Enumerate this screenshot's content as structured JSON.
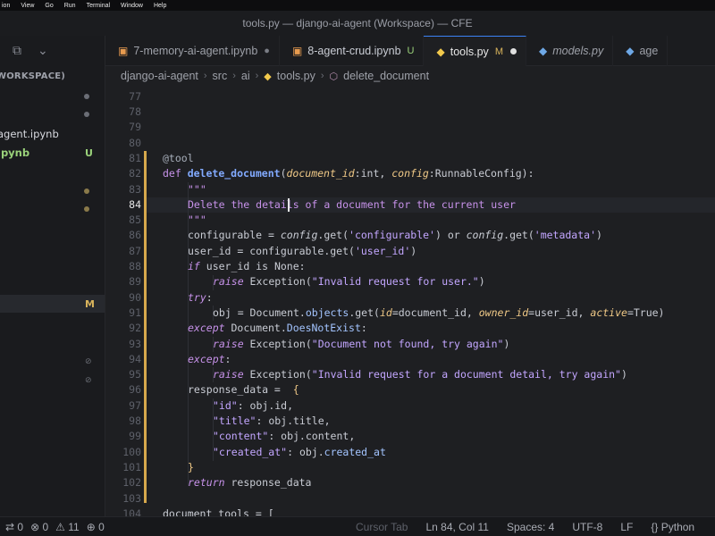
{
  "menubar": [
    "ion",
    "View",
    "Go",
    "Run",
    "Terminal",
    "Window",
    "Help"
  ],
  "window_title": "tools.py — django-ai-agent (Workspace) — CFE",
  "sidebar": {
    "header": "WORKSPACE)",
    "items": [
      {
        "label": "",
        "mark": "dot"
      },
      {
        "label": "",
        "mark": "dot"
      },
      {
        "label": "agent.ipynb",
        "mark": ""
      },
      {
        "label": "ipynb",
        "mark": "U"
      },
      {
        "label": "",
        "mark": "dot"
      },
      {
        "label": "",
        "mark": "dot"
      },
      {
        "label": "",
        "mark": "M"
      },
      {
        "label": "",
        "mark": "⊘"
      },
      {
        "label": "",
        "mark": "⊘"
      }
    ]
  },
  "tabs": [
    {
      "label": "7-memory-ai-agent.ipynb",
      "mark": "●",
      "active": false
    },
    {
      "label": "8-agent-crud.ipynb",
      "mark": "U",
      "active": false
    },
    {
      "label": "tools.py",
      "mark": "M",
      "active": true
    },
    {
      "label": "models.py",
      "mark": "",
      "active": false
    },
    {
      "label": "age",
      "mark": "",
      "active": false
    }
  ],
  "breadcrumb": [
    "django-ai-agent",
    "src",
    "ai",
    "tools.py",
    "delete_document"
  ],
  "editor": {
    "line_numbers": [
      "77",
      "78",
      "79",
      "80",
      "81",
      "82",
      "83",
      "84",
      "85",
      "86",
      "87",
      "88",
      "89",
      "90",
      "91",
      "92",
      "93",
      "94",
      "95",
      "96",
      "97",
      "98",
      "99",
      "100",
      "101",
      "102",
      "103",
      "104"
    ],
    "current_line": "84",
    "lines": {
      "l81": "@tool",
      "l82_def": "def ",
      "l82_name": "delete_document",
      "l82_p1": "document_id",
      "l82_t1": "int",
      "l82_p2": "config",
      "l82_t2": "RunnableConfig",
      "l83": "\"\"\"",
      "l84": "Delete the details of a document for the current user",
      "l85": "\"\"\"",
      "l86_a": "configurable = ",
      "l86_b": "config",
      "l86_c": ".get(",
      "l86_d": "'configurable'",
      "l86_e": ") or ",
      "l86_f": "config",
      "l86_g": ".get(",
      "l86_h": "'metadata'",
      "l86_i": ")",
      "l87_a": "user_id = configurable.get(",
      "l87_b": "'user_id'",
      "l87_c": ")",
      "l88_a": "if",
      "l88_b": " user_id is None:",
      "l89_a": "raise",
      "l89_b": " Exception(",
      "l89_c": "\"Invalid request for user.\"",
      "l89_d": ")",
      "l90": "try",
      "l91_a": "obj = Document.",
      "l91_b": "objects",
      "l91_c": ".get(",
      "l91_d": "id",
      "l91_e": "=document_id, ",
      "l91_f": "owner_id",
      "l91_g": "=user_id, ",
      "l91_h": "active",
      "l91_i": "=True)",
      "l92_a": "except",
      "l92_b": " Document.",
      "l92_c": "DoesNotExist",
      "l92_d": ":",
      "l93_a": "raise",
      "l93_b": " Exception(",
      "l93_c": "\"Document not found, try again\"",
      "l93_d": ")",
      "l94": "except",
      "l95_a": "raise",
      "l95_b": " Exception(",
      "l95_c": "\"Invalid request for a document detail, try again\"",
      "l95_d": ")",
      "l96_a": "response_data = ",
      "l96_b": " {",
      "l97_a": "\"id\"",
      "l97_b": ": obj.id,",
      "l98_a": "\"title\"",
      "l98_b": ": obj.title,",
      "l99_a": "\"content\"",
      "l99_b": ": obj.content,",
      "l100_a": "\"created_at\"",
      "l100_b": ": obj.",
      "l100_c": "created_at",
      "l101": "}",
      "l102_a": "return",
      "l102_b": " response_data",
      "l104": "document_tools = ["
    }
  },
  "status": {
    "sync": "⇄ 0",
    "errors": "⊗ 0",
    "warnings": "⚠ 11",
    "ports": "⊕ 0",
    "cursor_tab": "Cursor Tab",
    "position": "Ln 84, Col 11",
    "spaces": "Spaces: 4",
    "encoding": "UTF-8",
    "eol": "LF",
    "language": "Python"
  }
}
